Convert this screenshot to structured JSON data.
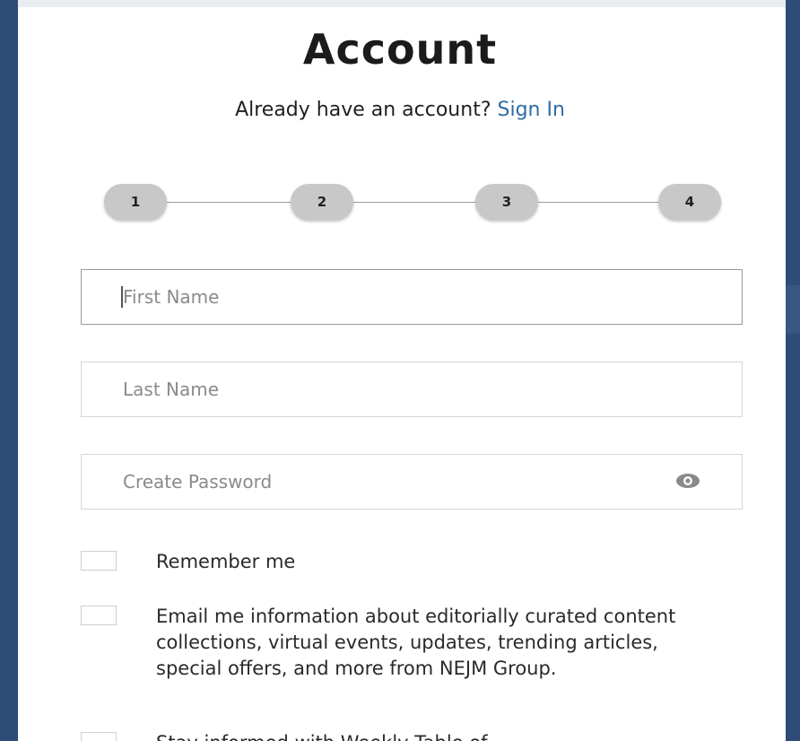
{
  "page": {
    "title": "Account",
    "already_text": "Already have an account?",
    "sign_in_label": "Sign In"
  },
  "steps": [
    "1",
    "2",
    "3",
    "4"
  ],
  "fields": {
    "first_name": {
      "placeholder": "First Name"
    },
    "last_name": {
      "placeholder": "Last Name"
    },
    "password": {
      "placeholder": "Create Password",
      "icon": "eye-icon"
    }
  },
  "checkboxes": {
    "remember_me": "Remember me",
    "email_me": "Email me information about editorially curated content collections, virtual events, updates, trending articles, special offers, and more from NEJM Group.",
    "weekly_toc": "Stay informed with Weekly Table of"
  },
  "colors": {
    "frame": "#2f4c78",
    "link": "#2e6da4",
    "step_circle": "#c8c8c8"
  }
}
